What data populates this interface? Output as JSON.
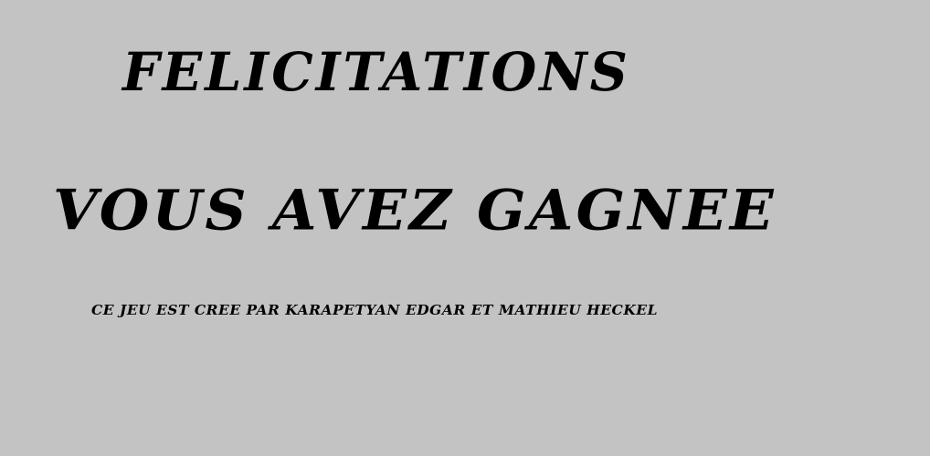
{
  "screen": {
    "title": "FELICITATIONS",
    "subtitle": "VOUS AVEZ GAGNEE",
    "credits": "CE JEU EST CREE PAR KARAPETYAN EDGAR ET MATHIEU HECKEL"
  },
  "colors": {
    "background": "#c3c3c3",
    "text": "#000000"
  }
}
